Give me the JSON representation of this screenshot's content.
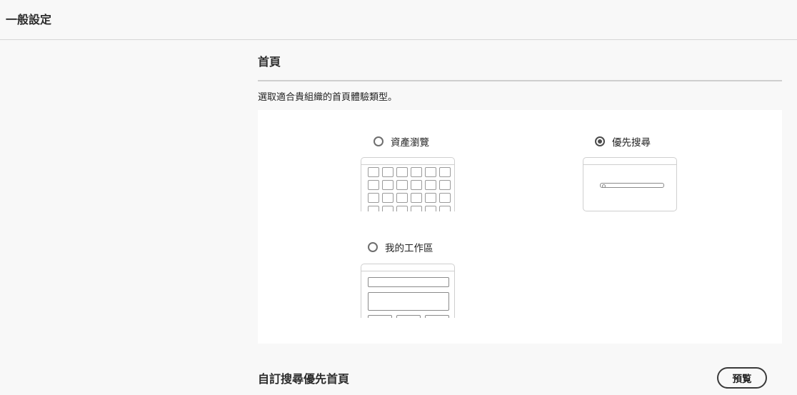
{
  "header": {
    "title": "一般設定"
  },
  "homepage": {
    "title": "首頁",
    "description": "選取適合貴組織的首頁體驗類型。",
    "options": [
      {
        "label": "資產瀏覽",
        "selected": false,
        "icon": "asset-grid-thumbnail"
      },
      {
        "label": "優先搜尋",
        "selected": true,
        "icon": "search-first-thumbnail"
      },
      {
        "label": "我的工作區",
        "selected": false,
        "icon": "workspace-thumbnail"
      }
    ]
  },
  "custom_search": {
    "title": "自訂搜尋優先首頁",
    "preview_label": "預覧"
  }
}
